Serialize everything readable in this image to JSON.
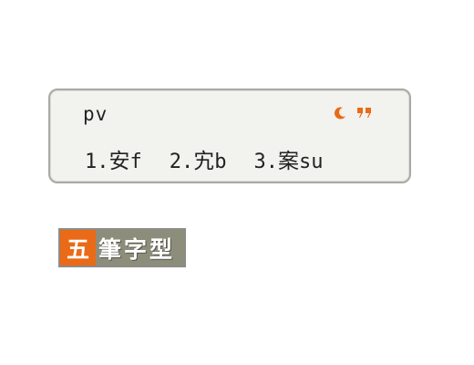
{
  "candidate_window": {
    "composition": "pv",
    "candidates": [
      {
        "index": "1.",
        "char": "安",
        "code": "f"
      },
      {
        "index": "2.",
        "char": "宄",
        "code": "b"
      },
      {
        "index": "3.",
        "char": "案",
        "code": "su"
      }
    ],
    "icons": {
      "half_width": "crescent-moon-icon",
      "chinese_punct": "chinese-punctuation-icon"
    },
    "icon_color": "#ea6a17"
  },
  "status_bar": {
    "first_char": "五",
    "rest_chars": "筆字型",
    "first_color": "#ea6a17",
    "rest_color": "#8d8d7c"
  }
}
